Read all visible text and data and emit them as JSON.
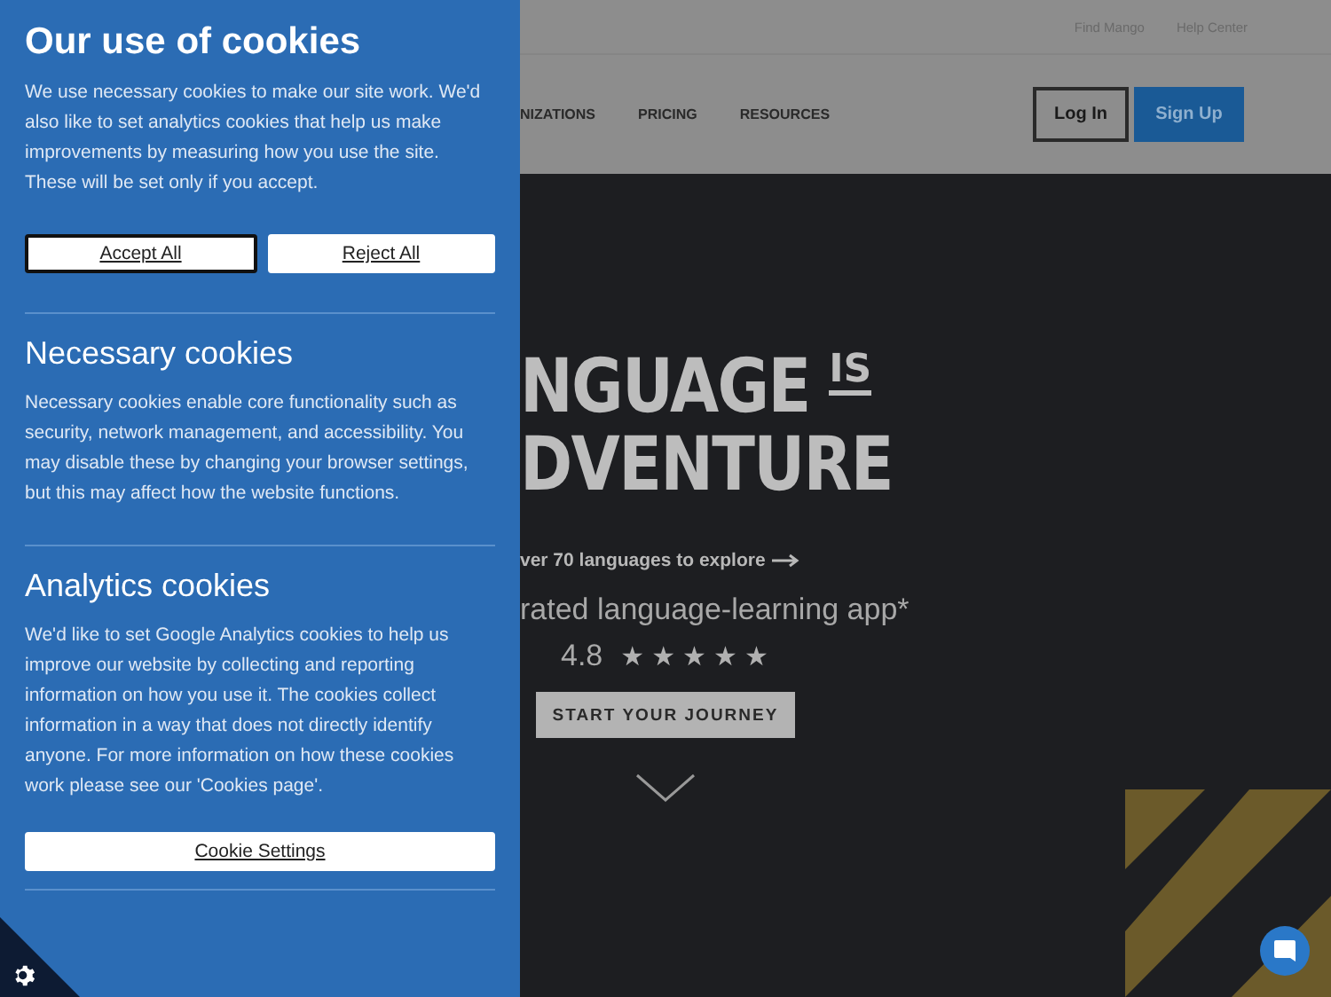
{
  "cookie_panel": {
    "title": "Our use of cookies",
    "intro": "We use necessary cookies to make our site work. We'd also like to set analytics cookies that help us make improvements by measuring how you use the site. These will be set only if you accept.",
    "buttons": [
      {
        "label": "Accept All",
        "focused": true
      },
      {
        "label": "Reject All",
        "focused": false
      }
    ],
    "sections": [
      {
        "title": "Necessary cookies",
        "text": "Necessary cookies enable core functionality such as security, network management, and accessibility. You may disable these by changing your browser settings, but this may affect how the website functions."
      },
      {
        "title": "Analytics cookies",
        "text": "We'd like to set Google Analytics cookies to help us improve our website by collecting and reporting information on how you use it. The cookies collect information in a way that does not directly identify anyone. For more information on how these cookies work please see our 'Cookies page'."
      }
    ],
    "settings_button": "Cookie Settings"
  },
  "top_links": [
    "Find Mango",
    "Help Center"
  ],
  "nav": {
    "items": [
      "NIZATIONS",
      "PRICING",
      "RESOURCES"
    ],
    "login": "Log In",
    "signup": "Sign Up"
  },
  "hero": {
    "headline_1": "NGUAGE",
    "headline_1b": "IS",
    "headline_2": "DVENTURE",
    "link": "ver 70 languages to explore",
    "subtitle": "rated language-learning app*",
    "rating": "4.8",
    "stars": 5,
    "cta": "START YOUR JOURNEY"
  }
}
